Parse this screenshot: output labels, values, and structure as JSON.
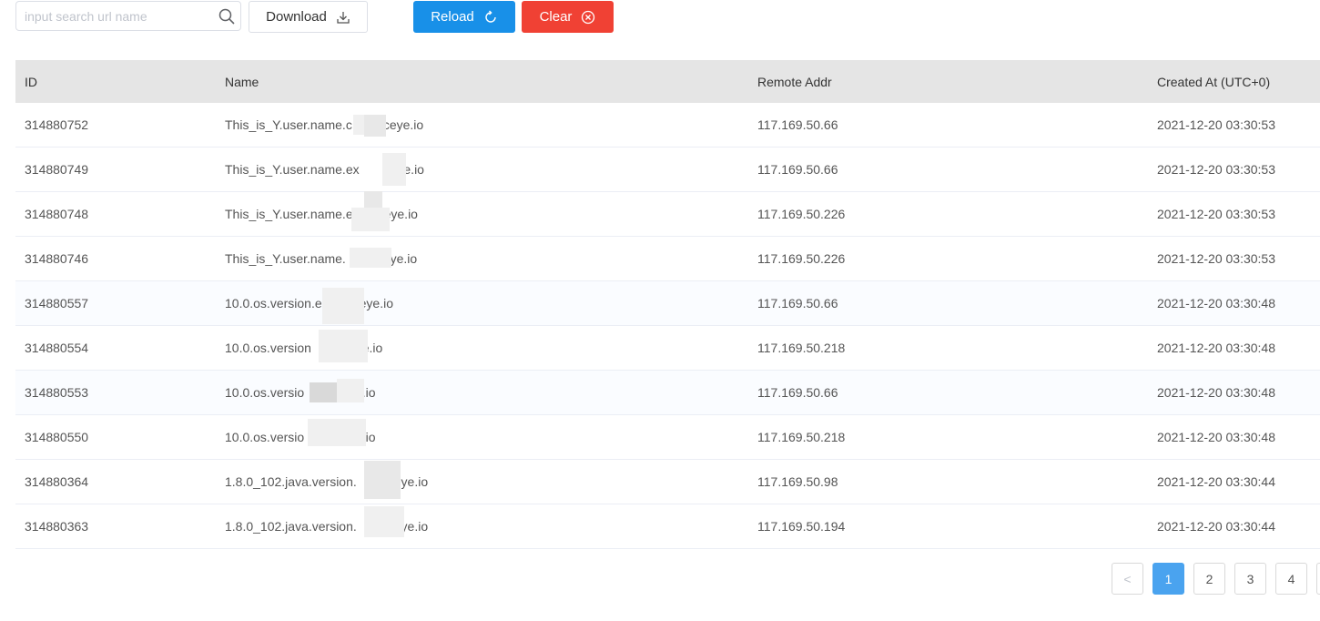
{
  "toolbar": {
    "search": {
      "placeholder": "input search url name",
      "value": ""
    },
    "download_label": "Download",
    "reload_label": "Reload",
    "clear_label": "Clear",
    "icons": [
      "search-icon",
      "download-icon",
      "reload-icon",
      "clear-circle-icon"
    ]
  },
  "table": {
    "columns": [
      "ID",
      "Name",
      "Remote Addr",
      "Created At (UTC+0)"
    ],
    "rows": [
      {
        "id": "314880752",
        "name": "This_is_Y.user.name.c",
        "name_suffix": "ceye.io",
        "addr": "117.169.50.66",
        "created": "2021-12-20 03:30:53"
      },
      {
        "id": "314880749",
        "name": "This_is_Y.user.name.ex",
        "name_suffix": "eye.io",
        "addr": "117.169.50.66",
        "created": "2021-12-20 03:30:53"
      },
      {
        "id": "314880748",
        "name": "This_is_Y.user.name.e",
        "name_suffix": "eye.io",
        "addr": "117.169.50.226",
        "created": "2021-12-20 03:30:53"
      },
      {
        "id": "314880746",
        "name": "This_is_Y.user.name.",
        "name_suffix": "ceye.io",
        "addr": "117.169.50.226",
        "created": "2021-12-20 03:30:53"
      },
      {
        "id": "314880557",
        "name": "10.0.os.version.e",
        "name_suffix": "ceye.io",
        "addr": "117.169.50.66",
        "created": "2021-12-20 03:30:48"
      },
      {
        "id": "314880554",
        "name": "10.0.os.version",
        "name_suffix": "ceye.io",
        "addr": "117.169.50.218",
        "created": "2021-12-20 03:30:48"
      },
      {
        "id": "314880553",
        "name": "10.0.os.versio",
        "name_suffix": "ceye.io",
        "addr": "117.169.50.66",
        "created": "2021-12-20 03:30:48"
      },
      {
        "id": "314880550",
        "name": "10.0.os.versio",
        "name_suffix": "ceye.io",
        "addr": "117.169.50.218",
        "created": "2021-12-20 03:30:48"
      },
      {
        "id": "314880364",
        "name": "1.8.0_102.java.version.",
        "name_suffix": "ceye.io",
        "addr": "117.169.50.98",
        "created": "2021-12-20 03:30:44"
      },
      {
        "id": "314880363",
        "name": "1.8.0_102.java.version.",
        "name_suffix": "ceye.io",
        "addr": "117.169.50.194",
        "created": "2021-12-20 03:30:44"
      }
    ]
  },
  "pagination": {
    "prev_label": "<",
    "pages": [
      "1",
      "2",
      "3",
      "4"
    ],
    "current": "1"
  },
  "colors": {
    "reload": "#1890e8",
    "clear": "#f04134",
    "page_active": "#4aa3ef",
    "header_bg": "#e5e5e5"
  }
}
